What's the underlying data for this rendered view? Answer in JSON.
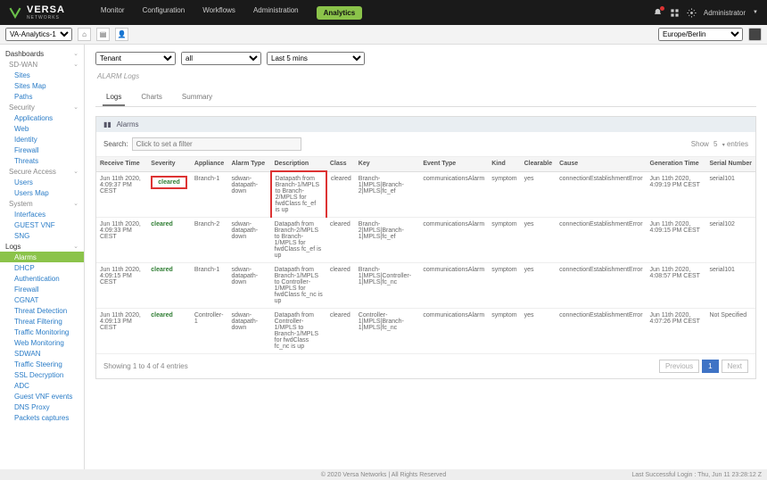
{
  "brand": {
    "name": "VERSA",
    "sub": "NETWORKS"
  },
  "nav": {
    "items": [
      "Monitor",
      "Configuration",
      "Workflows",
      "Administration",
      "Analytics"
    ],
    "active": 4,
    "admin": "Administrator",
    "tz": "Europe/Berlin"
  },
  "tenant": {
    "selector": "VA-Analytics-1"
  },
  "sidebar": {
    "items": [
      {
        "label": "Dashboards",
        "lvl": 0,
        "exp": true
      },
      {
        "label": "SD-WAN",
        "lvl": 1,
        "exp": true
      },
      {
        "label": "Sites",
        "lvl": 2
      },
      {
        "label": "Sites Map",
        "lvl": 2
      },
      {
        "label": "Paths",
        "lvl": 2
      },
      {
        "label": "Security",
        "lvl": 1,
        "exp": true
      },
      {
        "label": "Applications",
        "lvl": 2
      },
      {
        "label": "Web",
        "lvl": 2
      },
      {
        "label": "Identity",
        "lvl": 2
      },
      {
        "label": "Firewall",
        "lvl": 2
      },
      {
        "label": "Threats",
        "lvl": 2
      },
      {
        "label": "Secure Access",
        "lvl": 1,
        "exp": true
      },
      {
        "label": "Users",
        "lvl": 2
      },
      {
        "label": "Users Map",
        "lvl": 2
      },
      {
        "label": "System",
        "lvl": 1,
        "exp": true
      },
      {
        "label": "Interfaces",
        "lvl": 2
      },
      {
        "label": "GUEST VNF",
        "lvl": 2
      },
      {
        "label": "SNG",
        "lvl": 2
      },
      {
        "label": "Logs",
        "lvl": 0,
        "exp": true
      },
      {
        "label": "Alarms",
        "lvl": 2,
        "sel": true
      },
      {
        "label": "DHCP",
        "lvl": 2
      },
      {
        "label": "Authentication",
        "lvl": 2
      },
      {
        "label": "Firewall",
        "lvl": 2
      },
      {
        "label": "CGNAT",
        "lvl": 2
      },
      {
        "label": "Threat Detection",
        "lvl": 2
      },
      {
        "label": "Threat Filtering",
        "lvl": 2
      },
      {
        "label": "Traffic Monitoring",
        "lvl": 2
      },
      {
        "label": "Web Monitoring",
        "lvl": 2
      },
      {
        "label": "SDWAN",
        "lvl": 2
      },
      {
        "label": "Traffic Steering",
        "lvl": 2
      },
      {
        "label": "SSL Decryption",
        "lvl": 2
      },
      {
        "label": "ADC",
        "lvl": 2
      },
      {
        "label": "Guest VNF events",
        "lvl": 2
      },
      {
        "label": "DNS Proxy",
        "lvl": 2
      },
      {
        "label": "Packets captures",
        "lvl": 2
      }
    ]
  },
  "filters": {
    "tenant": "Tenant",
    "all": "all",
    "range": "Last 5 mins"
  },
  "panel": {
    "title": "ALARM Logs",
    "tabs": [
      "Logs",
      "Charts",
      "Summary"
    ],
    "activeTab": 0,
    "sub": "Alarms"
  },
  "search": {
    "label": "Search:",
    "placeholder": "Click to set a filter",
    "show": "Show",
    "entries": "entries",
    "val": "5"
  },
  "columns": [
    "Receive Time",
    "Severity",
    "Appliance",
    "Alarm Type",
    "Description",
    "Class",
    "Key",
    "Event Type",
    "Kind",
    "Clearable",
    "Cause",
    "Generation Time",
    "Serial Number"
  ],
  "rows": [
    {
      "time": "Jun 11th 2020, 4:09:37 PM CEST",
      "sev": "cleared",
      "sevhl": true,
      "app": "Branch-1",
      "type": "sdwan-datapath-down",
      "desc": "Datapath from Branch-1/MPLS to Branch-2/MPLS for fwdClass fc_ef is up",
      "deschl": true,
      "cls": "cleared",
      "key": "Branch-1|MPLS|Branch-2|MPLS|fc_ef",
      "ev": "communicationsAlarm",
      "kind": "symptom",
      "clr": "yes",
      "cause": "connectionEstablishmentError",
      "gen": "Jun 11th 2020, 4:09:19 PM CEST",
      "ser": "serial101"
    },
    {
      "time": "Jun 11th 2020, 4:09:33 PM CEST",
      "sev": "cleared",
      "app": "Branch-2",
      "type": "sdwan-datapath-down",
      "desc": "Datapath from Branch-2/MPLS to Branch-1/MPLS for fwdClass fc_ef is up",
      "cls": "cleared",
      "key": "Branch-2|MPLS|Branch-1|MPLS|fc_ef",
      "ev": "communicationsAlarm",
      "kind": "symptom",
      "clr": "yes",
      "cause": "connectionEstablishmentError",
      "gen": "Jun 11th 2020, 4:09:15 PM CEST",
      "ser": "serial102"
    },
    {
      "time": "Jun 11th 2020, 4:09:15 PM CEST",
      "sev": "cleared",
      "app": "Branch-1",
      "type": "sdwan-datapath-down",
      "desc": "Datapath from Branch-1/MPLS to Controller-1/MPLS for fwdClass fc_nc is up",
      "cls": "cleared",
      "key": "Branch-1|MPLS|Controller-1|MPLS|fc_nc",
      "ev": "communicationsAlarm",
      "kind": "symptom",
      "clr": "yes",
      "cause": "connectionEstablishmentError",
      "gen": "Jun 11th 2020, 4:08:57 PM CEST",
      "ser": "serial101"
    },
    {
      "time": "Jun 11th 2020, 4:09:13 PM CEST",
      "sev": "cleared",
      "app": "Controller-1",
      "type": "sdwan-datapath-down",
      "desc": "Datapath from Controller-1/MPLS to Branch-1/MPLS for fwdClass fc_nc is up",
      "cls": "cleared",
      "key": "Controller-1|MPLS|Branch-1|MPLS|fc_nc",
      "ev": "communicationsAlarm",
      "kind": "symptom",
      "clr": "yes",
      "cause": "connectionEstablishmentError",
      "gen": "Jun 11th 2020, 4:07:26 PM CEST",
      "ser": "Not Specified"
    }
  ],
  "footer": {
    "info": "Showing 1 to 4 of 4 entries",
    "prev": "Previous",
    "page": "1",
    "next": "Next"
  },
  "pagefoot": {
    "copy": "© 2020 Versa Networks | All Rights Reserved",
    "login": "Last Successful Login : Thu, Jun 11 23:28:12 Z"
  }
}
